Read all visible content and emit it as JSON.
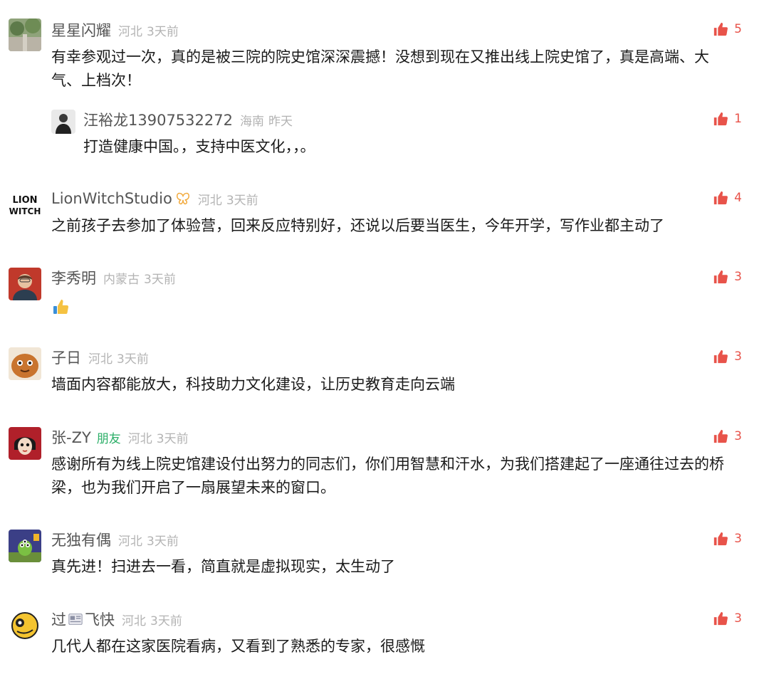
{
  "colors": {
    "like": "#e8534a",
    "name": "#555555",
    "meta": "#b3b3b3",
    "friend": "#2aae67"
  },
  "comments": [
    {
      "name": "星星闪耀",
      "location": "河北",
      "time": "3天前",
      "likes": "5",
      "text": "有幸参观过一次，真的是被三院的院史馆深深震撼！没想到现在又推出线上院史馆了，真是高端、大气、上档次！",
      "reply": {
        "name": "汪裕龙13907532272",
        "location": "海南",
        "time": "昨天",
        "likes": "1",
        "text": "打造健康中国。，支持中医文化，，。"
      }
    },
    {
      "name": "LionWitchStudio",
      "location": "河北",
      "time": "3天前",
      "likes": "4",
      "text": "之前孩子去参加了体验营，回来反应特别好，还说以后要当医生，今年开学，写作业都主动了"
    },
    {
      "name": "李秀明",
      "location": "内蒙古",
      "time": "3天前",
      "likes": "3",
      "text_icon": "thumbs-up-emoji"
    },
    {
      "name": "子日",
      "location": "河北",
      "time": "3天前",
      "likes": "3",
      "text": "墙面内容都能放大，科技助力文化建设，让历史教育走向云端"
    },
    {
      "name": "张-ZY",
      "friend": "朋友",
      "location": "河北",
      "time": "3天前",
      "likes": "3",
      "text": "感谢所有为线上院史馆建设付出努力的同志们，你们用智慧和汗水，为我们搭建起了一座通往过去的桥梁，也为我们开启了一扇展望未来的窗口。"
    },
    {
      "name": "无独有偶",
      "location": "河北",
      "time": "3天前",
      "likes": "3",
      "text": "真先进！扫进去一看，简直就是虚拟现实，太生动了"
    },
    {
      "name_a": "过",
      "name_b": "飞快",
      "location": "河北",
      "time": "3天前",
      "likes": "3",
      "text": "几代人都在这家医院看病，又看到了熟悉的专家，很感慨"
    }
  ]
}
